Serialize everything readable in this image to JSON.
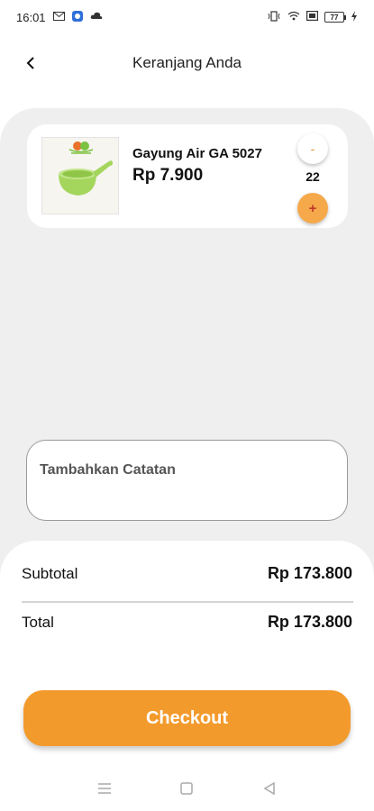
{
  "status_bar": {
    "time": "16:01",
    "battery": "77"
  },
  "header": {
    "title": "Keranjang Anda"
  },
  "cart": {
    "items": [
      {
        "name": "Gayung Air GA 5027",
        "price": "Rp 7.900",
        "quantity": "22",
        "minus_label": "-",
        "plus_label": "+"
      }
    ]
  },
  "note": {
    "placeholder": "Tambahkan Catatan"
  },
  "summary": {
    "subtotal_label": "Subtotal",
    "subtotal_value": "Rp 173.800",
    "total_label": "Total",
    "total_value": "Rp 173.800"
  },
  "checkout": {
    "label": "Checkout"
  },
  "colors": {
    "accent": "#f39a2c",
    "panel_gray": "#efefef",
    "plus_button": "#f5a94a"
  },
  "icons": {
    "back": "chevron-left-icon",
    "nav_menu": "menu-icon",
    "nav_home": "home-square-icon",
    "nav_back": "triangle-back-icon"
  }
}
